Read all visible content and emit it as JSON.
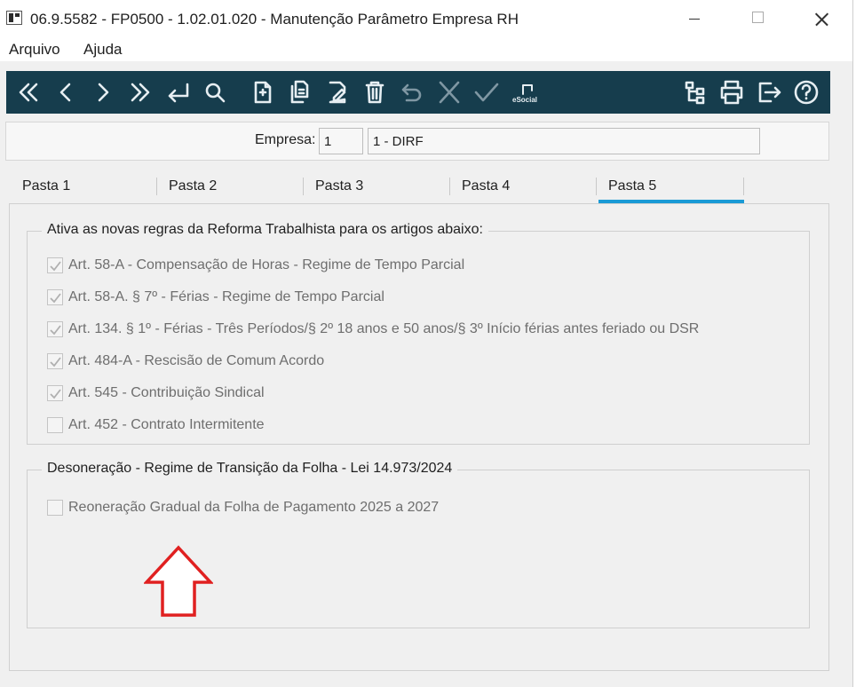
{
  "window": {
    "title": "06.9.5582 - FP0500 - 1.02.01.020 - Manutenção Parâmetro Empresa RH"
  },
  "menu": {
    "items": [
      {
        "label": "Arquivo"
      },
      {
        "label": "Ajuda"
      }
    ]
  },
  "toolbar": {
    "background": "#163d4d",
    "buttons": [
      {
        "icon": "first-record-icon"
      },
      {
        "icon": "previous-record-icon"
      },
      {
        "icon": "next-record-icon"
      },
      {
        "icon": "last-record-icon"
      },
      {
        "icon": "go-to-icon"
      },
      {
        "icon": "search-icon"
      },
      {
        "icon": "new-record-icon"
      },
      {
        "icon": "copy-record-icon"
      },
      {
        "icon": "edit-record-icon"
      },
      {
        "icon": "delete-icon"
      },
      {
        "icon": "undo-icon"
      },
      {
        "icon": "cancel-icon"
      },
      {
        "icon": "confirm-icon"
      },
      {
        "icon": "esocial-icon",
        "label": "eSocial"
      },
      {
        "icon": "structure-icon"
      },
      {
        "icon": "print-icon"
      },
      {
        "icon": "exit-icon"
      },
      {
        "icon": "help-icon"
      }
    ]
  },
  "empresa": {
    "label": "Empresa:",
    "code": "1",
    "description": "1 - DIRF"
  },
  "tabs": [
    {
      "label": "Pasta 1",
      "active": false
    },
    {
      "label": "Pasta 2",
      "active": false
    },
    {
      "label": "Pasta 3",
      "active": false
    },
    {
      "label": "Pasta 4",
      "active": false
    },
    {
      "label": "Pasta 5",
      "active": true
    }
  ],
  "tab_accent": "#1a9ad6",
  "reforma_group": {
    "title": "Ativa as novas regras da Reforma Trabalhista para os artigos abaixo:",
    "items": [
      {
        "label": "Art. 58-A - Compensação de Horas - Regime de Tempo Parcial",
        "checked": true
      },
      {
        "label": "Art. 58-A. § 7º - Férias - Regime de Tempo Parcial",
        "checked": true
      },
      {
        "label": "Art. 134. § 1º - Férias - Três Períodos/§ 2º 18 anos e 50 anos/§ 3º Início férias antes feriado ou DSR",
        "checked": true
      },
      {
        "label": "Art. 484-A - Rescisão de Comum Acordo",
        "checked": true
      },
      {
        "label": "Art. 545 - Contribuição Sindical",
        "checked": true
      },
      {
        "label": "Art. 452 - Contrato Intermitente",
        "checked": false
      }
    ]
  },
  "desoneracao_group": {
    "title": "Desoneração - Regime de Transição da Folha - Lei 14.973/2024",
    "items": [
      {
        "label": "Reoneração Gradual da Folha de Pagamento 2025 a 2027",
        "checked": false
      }
    ]
  },
  "annotation": {
    "icon": "red-up-arrow-icon",
    "color": "#e02020"
  }
}
